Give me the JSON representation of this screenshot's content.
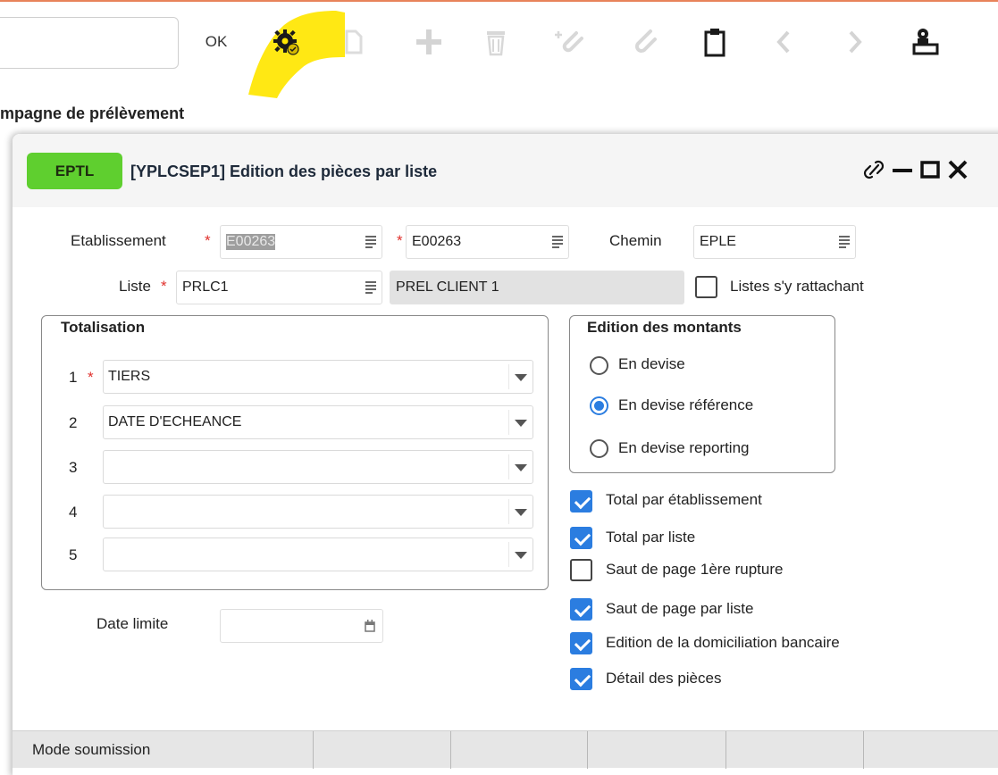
{
  "toolbar": {
    "ok_label": "OK",
    "icons": [
      "gear-run-icon",
      "copy-icon",
      "add-icon",
      "delete-icon",
      "attach-add-icon",
      "attach-icon",
      "clipboard-icon",
      "prev-icon",
      "next-icon",
      "user-stamp-icon"
    ],
    "highlight_color": "#ffe600"
  },
  "page": {
    "heading": "mpagne de prélèvement"
  },
  "dialog": {
    "badge": "EPTL",
    "title": "[YPLCSEP1] Edition des pièces par liste",
    "badge_color": "#5fcf2f"
  },
  "form": {
    "etablissement_label": "Etablissement",
    "etablissement_value": "E00263",
    "etablissement_value2": "E00263",
    "chemin_label": "Chemin",
    "chemin_value": "EPLE",
    "liste_label": "Liste",
    "liste_value": "PRLC1",
    "liste_desc": "PREL CLIENT 1",
    "listes_rattachant_label": "Listes s'y rattachant",
    "listes_rattachant_checked": false,
    "date_limite_label": "Date limite",
    "date_limite_value": ""
  },
  "totalisation": {
    "title": "Totalisation",
    "rows": [
      {
        "num": "1",
        "value": "TIERS",
        "required": true
      },
      {
        "num": "2",
        "value": "DATE D'ECHEANCE",
        "required": false
      },
      {
        "num": "3",
        "value": "",
        "required": false
      },
      {
        "num": "4",
        "value": "",
        "required": false
      },
      {
        "num": "5",
        "value": "",
        "required": false
      }
    ]
  },
  "montants": {
    "title": "Edition des montants",
    "options": [
      {
        "label": "En devise",
        "selected": false
      },
      {
        "label": "En devise référence",
        "selected": true
      },
      {
        "label": "En devise reporting",
        "selected": false
      }
    ]
  },
  "options": [
    {
      "label": "Total par établissement",
      "checked": true
    },
    {
      "label": "Total par liste",
      "checked": true
    },
    {
      "label": "Saut de page 1ère rupture",
      "checked": false
    },
    {
      "label": "Saut de page par liste",
      "checked": true
    },
    {
      "label": "Edition de la domiciliation bancaire",
      "checked": true
    },
    {
      "label": "Détail des pièces",
      "checked": true
    }
  ],
  "statusbar": {
    "mode_label": "Mode soumission"
  },
  "colors": {
    "accent_blue": "#2b7de0",
    "required_red": "#e0302c"
  }
}
